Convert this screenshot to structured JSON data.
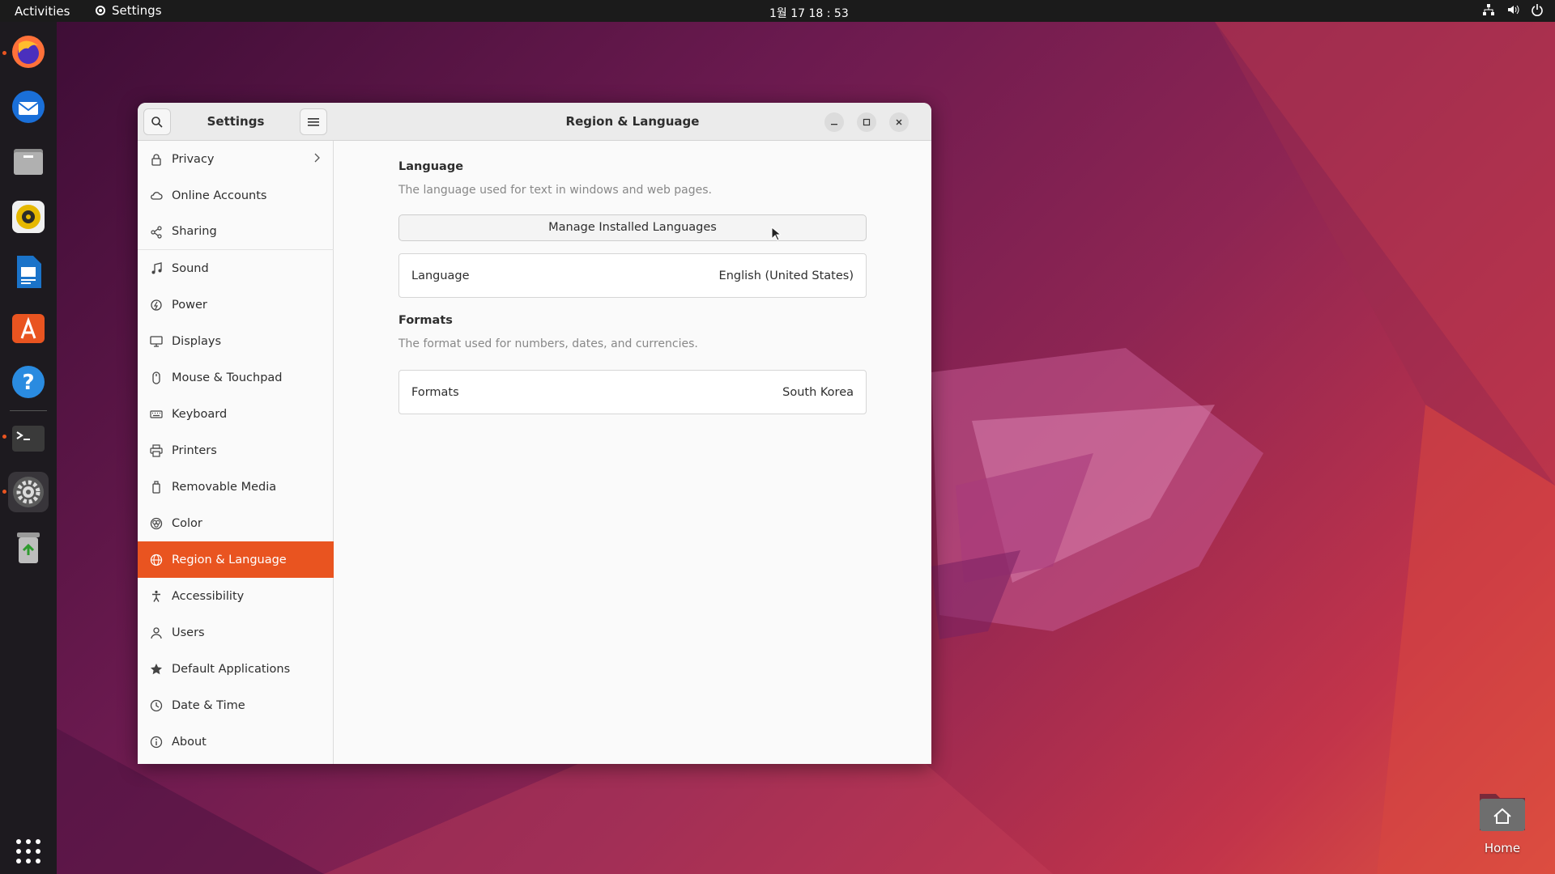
{
  "topbar": {
    "activities": "Activities",
    "app_name": "Settings",
    "clock": "1월 17  18 : 53"
  },
  "sidebar": {
    "title": "Settings",
    "items": [
      {
        "label": "Privacy",
        "icon": "lock-icon",
        "has_chevron": true
      },
      {
        "label": "Online Accounts",
        "icon": "cloud-icon"
      },
      {
        "label": "Sharing",
        "icon": "share-icon"
      },
      {
        "label": "Sound",
        "icon": "music-note-icon"
      },
      {
        "label": "Power",
        "icon": "power-icon"
      },
      {
        "label": "Displays",
        "icon": "display-icon"
      },
      {
        "label": "Mouse & Touchpad",
        "icon": "mouse-icon"
      },
      {
        "label": "Keyboard",
        "icon": "keyboard-icon"
      },
      {
        "label": "Printers",
        "icon": "printer-icon"
      },
      {
        "label": "Removable Media",
        "icon": "usb-drive-icon"
      },
      {
        "label": "Color",
        "icon": "color-icon"
      },
      {
        "label": "Region & Language",
        "icon": "globe-icon",
        "selected": true
      },
      {
        "label": "Accessibility",
        "icon": "accessibility-icon"
      },
      {
        "label": "Users",
        "icon": "user-icon"
      },
      {
        "label": "Default Applications",
        "icon": "star-icon"
      },
      {
        "label": "Date & Time",
        "icon": "clock-icon"
      },
      {
        "label": "About",
        "icon": "info-icon"
      }
    ]
  },
  "main": {
    "title": "Region & Language",
    "language_section": {
      "title": "Language",
      "subtitle": "The language used for text in windows and web pages.",
      "manage_button": "Manage Installed Languages",
      "row_label": "Language",
      "row_value": "English (United States)"
    },
    "formats_section": {
      "title": "Formats",
      "subtitle": "The format used for numbers, dates, and currencies.",
      "row_label": "Formats",
      "row_value": "South Korea"
    }
  },
  "desktop": {
    "home_label": "Home"
  },
  "colors": {
    "accent": "#e95420",
    "topbar": "#1b1b1b",
    "dock": "#1d1a1f"
  }
}
